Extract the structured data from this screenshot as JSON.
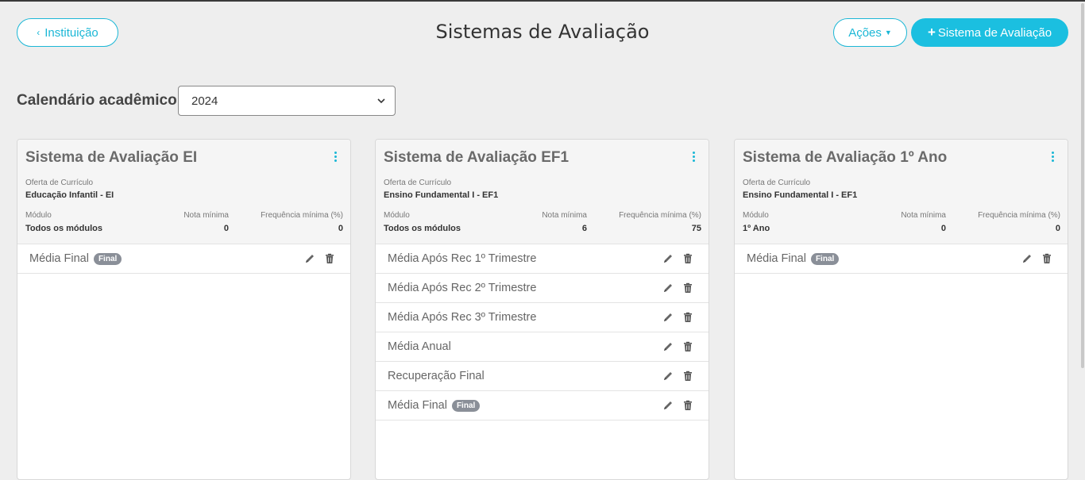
{
  "header": {
    "back_label": "Instituição",
    "title": "Sistemas de Avaliação",
    "actions_label": "Ações",
    "add_label": "Sistema de Avaliação"
  },
  "calendar": {
    "label": "Calendário acadêmico:",
    "selected": "2024"
  },
  "cards": [
    {
      "title": "Sistema de Avaliação EI",
      "curriculum_label": "Oferta de Currículo",
      "curriculum": "Educação Infantil - EI",
      "module_label": "Módulo",
      "module": "Todos os módulos",
      "min_grade_label": "Nota mínima",
      "min_grade": "0",
      "min_freq_label": "Frequência mínima (%)",
      "min_freq": "0",
      "items": [
        {
          "name": "Média Final",
          "badge": "Final"
        }
      ]
    },
    {
      "title": "Sistema de Avaliação EF1",
      "curriculum_label": "Oferta de Currículo",
      "curriculum": "Ensino Fundamental I - EF1",
      "module_label": "Módulo",
      "module": "Todos os módulos",
      "min_grade_label": "Nota mínima",
      "min_grade": "6",
      "min_freq_label": "Frequência mínima (%)",
      "min_freq": "75",
      "items": [
        {
          "name": "Média Após Rec 1º Trimestre"
        },
        {
          "name": "Média Após Rec 2º Trimestre"
        },
        {
          "name": "Média Após Rec 3º Trimestre"
        },
        {
          "name": "Média Anual"
        },
        {
          "name": "Recuperação Final"
        },
        {
          "name": "Média Final",
          "badge": "Final"
        }
      ]
    },
    {
      "title": "Sistema de Avaliação 1º Ano",
      "curriculum_label": "Oferta de Currículo",
      "curriculum": "Ensino Fundamental I - EF1",
      "module_label": "Módulo",
      "module": "1º Ano",
      "min_grade_label": "Nota mínima",
      "min_grade": "0",
      "min_freq_label": "Frequência mínima (%)",
      "min_freq": "0",
      "items": [
        {
          "name": "Média Final",
          "badge": "Final"
        }
      ]
    }
  ],
  "icons": {
    "back": "chevron-left-icon",
    "actions_caret": "caret-down-icon",
    "add": "plus-icon",
    "select_caret": "chevron-down-icon",
    "menu": "kebab-menu-icon",
    "edit": "pencil-icon",
    "delete": "trash-icon"
  },
  "colors": {
    "accent": "#1bb7d6",
    "badge": "#8a8f98",
    "background": "#eeeeee"
  }
}
